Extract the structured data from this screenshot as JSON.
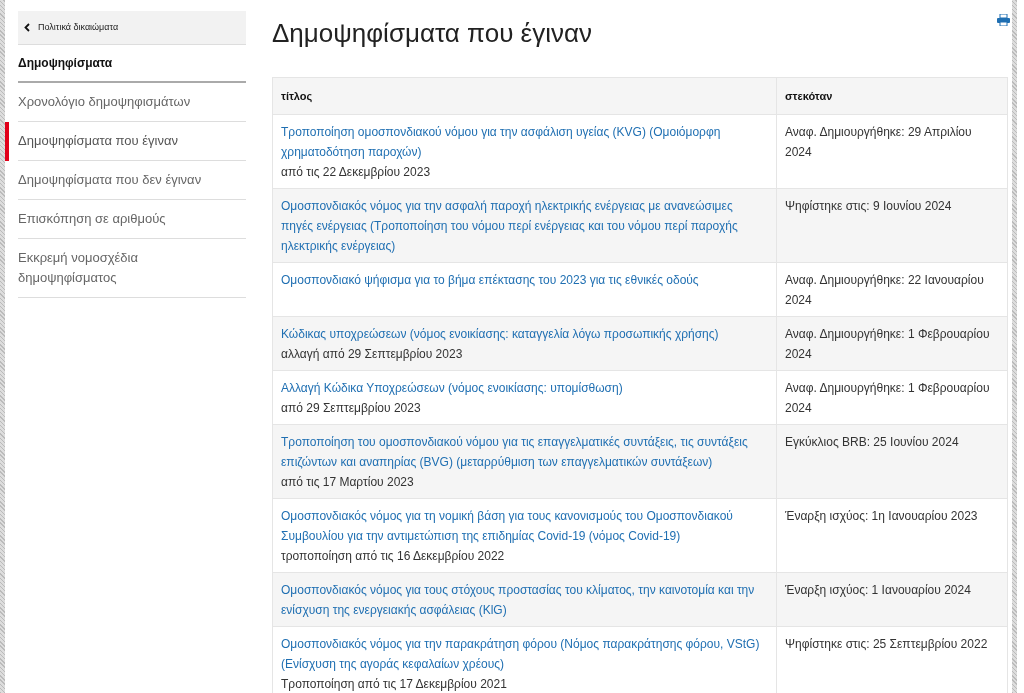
{
  "sidebar": {
    "back_link": "Πολιτικά δικαιώματα",
    "heading": "Δημοψηφίσματα",
    "items": [
      {
        "label": "Χρονολόγιο δημοψηφισμάτων",
        "selected": false
      },
      {
        "label": "Δημοψηφίσματα που έγιναν",
        "selected": true
      },
      {
        "label": "Δημοψηφίσματα που δεν έγιναν",
        "selected": false
      },
      {
        "label": "Επισκόπηση σε αριθμούς",
        "selected": false
      },
      {
        "label": "Εκκρεμή νομοσχέδια δημοψηφίσματος",
        "selected": false
      }
    ]
  },
  "page_title": "Δημοψηφίσματα που έγιναν",
  "table": {
    "columns": [
      "τίτλος",
      "στεκόταν"
    ],
    "rows": [
      {
        "title": "Τροποποίηση ομοσπονδιακού νόμου για την ασφάλιση υγείας (KVG) (Ομοιόμορφη χρηματοδότηση παροχών)",
        "note": "από τις 22 Δεκεμβρίου 2023",
        "status": "Αναφ. Δημιουργήθηκε: 29 Απριλίου 2024"
      },
      {
        "title": "Ομοσπονδιακός νόμος για την ασφαλή παροχή ηλεκτρικής ενέργειας με ανανεώσιμες πηγές ενέργειας (Τροποποίηση του νόμου περί ενέργειας και του νόμου περί παροχής ηλεκτρικής ενέργειας)",
        "status": "Ψηφίστηκε στις: 9 Ιουνίου 2024"
      },
      {
        "title": "Ομοσπονδιακό ψήφισμα για το βήμα επέκτασης του 2023 για τις εθνικές οδούς",
        "status": "Αναφ. Δημιουργήθηκε: 22 Ιανουαρίου 2024"
      },
      {
        "title": "Κώδικας υποχρεώσεων (νόμος ενοικίασης: καταγγελία λόγω προσωπικής χρήσης)",
        "note": "αλλαγή από 29 Σεπτεμβρίου 2023",
        "status": "Αναφ. Δημιουργήθηκε: 1 Φεβρουαρίου 2024"
      },
      {
        "title": "Αλλαγή Κώδικα Υποχρεώσεων (νόμος ενοικίασης: υπομίσθωση)",
        "note": "από 29 Σεπτεμβρίου 2023",
        "status": "Αναφ. Δημιουργήθηκε: 1 Φεβρουαρίου 2024"
      },
      {
        "title": "Τροποποίηση του ομοσπονδιακού νόμου για τις επαγγελματικές συντάξεις, τις συντάξεις επιζώντων και αναπηρίας (BVG) (μεταρρύθμιση των επαγγελματικών συντάξεων)",
        "note": "από τις 17 Μαρτίου 2023",
        "status": "Εγκύκλιος BRB: 25 Ιουνίου 2024"
      },
      {
        "title": "Ομοσπονδιακός νόμος για τη νομική βάση για τους κανονισμούς του Ομοσπονδιακού Συμβουλίου για την αντιμετώπιση της επιδημίας Covid-19 (νόμος Covid-19)",
        "note": "τροποποίηση από τις 16 Δεκεμβρίου 2022",
        "status": "Έναρξη ισχύος: 1η Ιανουαρίου 2023"
      },
      {
        "title": "Ομοσπονδιακός νόμος για τους στόχους προστασίας του κλίματος, την καινοτομία και την ενίσχυση της ενεργειακής ασφάλειας (KlG)",
        "status": "Έναρξη ισχύος: 1 Ιανουαρίου 2024"
      },
      {
        "title": "Ομοσπονδιακός νόμος για την παρακράτηση φόρου (Νόμος παρακράτησης φόρου, VStG) (Ενίσχυση της αγοράς κεφαλαίων χρέους)",
        "note": "Τροποποίηση από τις 17 Δεκεμβρίου 2021",
        "status": "Ψηφίστηκε στις: 25 Σεπτεμβρίου 2022"
      }
    ]
  }
}
